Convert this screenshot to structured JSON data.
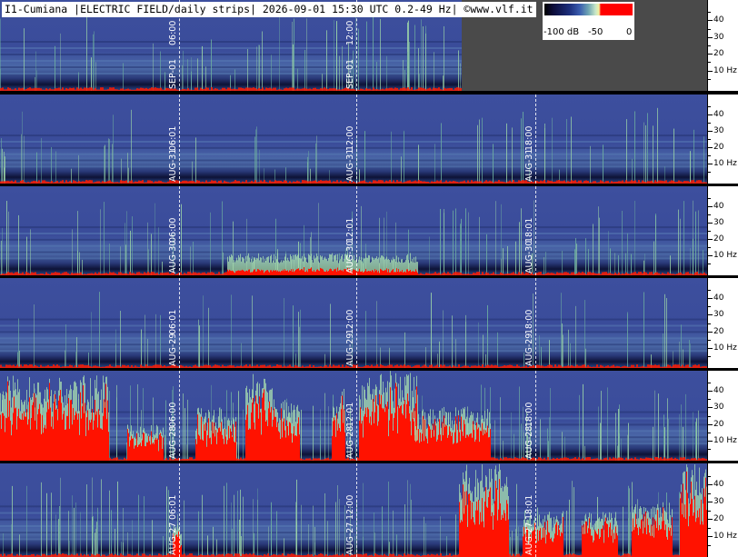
{
  "title": "I1-Cumiana |ELECTRIC FIELD/daily strips| 2026-09-01 15:30 UTC 0.2-49 Hz| ©www.vlf.it",
  "colorbar": {
    "labels": [
      "-100 dB",
      "-50",
      "0"
    ],
    "colors": [
      "#000000",
      "#1b2d7a",
      "#3a5cae",
      "#c8e6c8",
      "#ff0000"
    ]
  },
  "axis_labels": [
    "40",
    "30",
    "20",
    "10 Hz"
  ],
  "strips": [
    {
      "id": "sep-01",
      "date": "SEP-01",
      "markers": [
        "06:00",
        "12:00"
      ],
      "activity": "low"
    },
    {
      "id": "aug-31",
      "date": "AUG-31",
      "markers": [
        "06:01",
        "12:00",
        "18:00"
      ],
      "activity": "low"
    },
    {
      "id": "aug-30",
      "date": "AUG-30",
      "markers": [
        "06:00",
        "12:01",
        "18:01"
      ],
      "activity": "medium"
    },
    {
      "id": "aug-29",
      "date": "AUG-29",
      "markers": [
        "06:01",
        "12:00",
        "18:00"
      ],
      "activity": "low"
    },
    {
      "id": "aug-28",
      "date": "AUG-28",
      "markers": [
        "06:00",
        "12:01",
        "18:00"
      ],
      "activity": "high"
    },
    {
      "id": "aug-27",
      "date": "AUG-27",
      "markers": [
        "06:01",
        "12:00",
        "18:01"
      ],
      "activity": "high"
    }
  ]
}
